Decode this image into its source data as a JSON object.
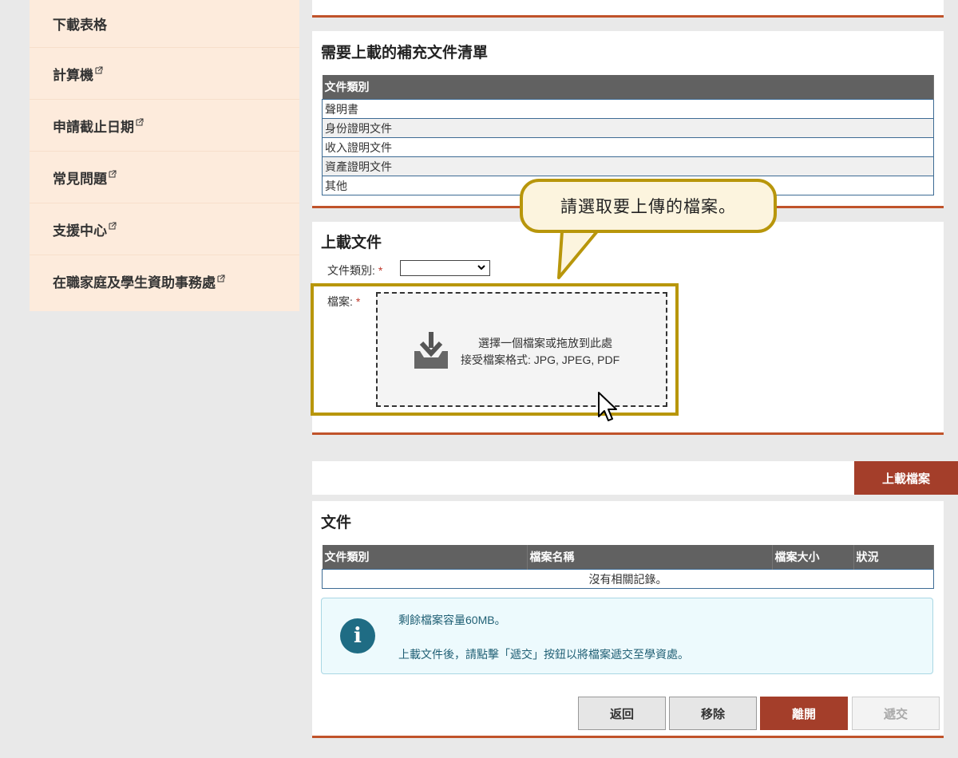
{
  "sidebar": {
    "items": [
      {
        "label": "下載表格"
      },
      {
        "label": "計算機"
      },
      {
        "label": "申請截止日期"
      },
      {
        "label": "常見問題"
      },
      {
        "label": "支援中心"
      },
      {
        "label": "在職家庭及學生資助事務處"
      }
    ]
  },
  "supplementary": {
    "title": "需要上載的補充文件清單",
    "column": "文件類別",
    "rows": [
      "聲明書",
      "身份證明文件",
      "收入證明文件",
      "資產證明文件",
      "其他"
    ]
  },
  "upload_section": {
    "title": "上載文件",
    "doc_type_label": "文件類別:",
    "required_mark": "*",
    "doc_type_value": "",
    "file_label": "檔案:",
    "dropzone_line1": "選擇一個檔案或拖放到此處",
    "dropzone_line2": "接受檔案格式: JPG, JPEG, PDF"
  },
  "tooltip": {
    "text": "請選取要上傳的檔案。"
  },
  "upload_button": "上載檔案",
  "documents": {
    "title": "文件",
    "columns": [
      "文件類別",
      "檔案名稱",
      "檔案大小",
      "狀況"
    ],
    "empty_text": "沒有相關記錄。"
  },
  "info": {
    "line1": "剩餘檔案容量60MB。",
    "line2": "上載文件後，請點擊「遞交」按鈕以將檔案遞交至學資處。"
  },
  "buttons": {
    "back": "返回",
    "remove": "移除",
    "leave": "離開",
    "submit": "遞交"
  },
  "colors": {
    "accent": "#c0532a",
    "button_red": "#a43e2a",
    "highlight": "#b8960b",
    "sidebar_bg": "#fdebdc"
  }
}
